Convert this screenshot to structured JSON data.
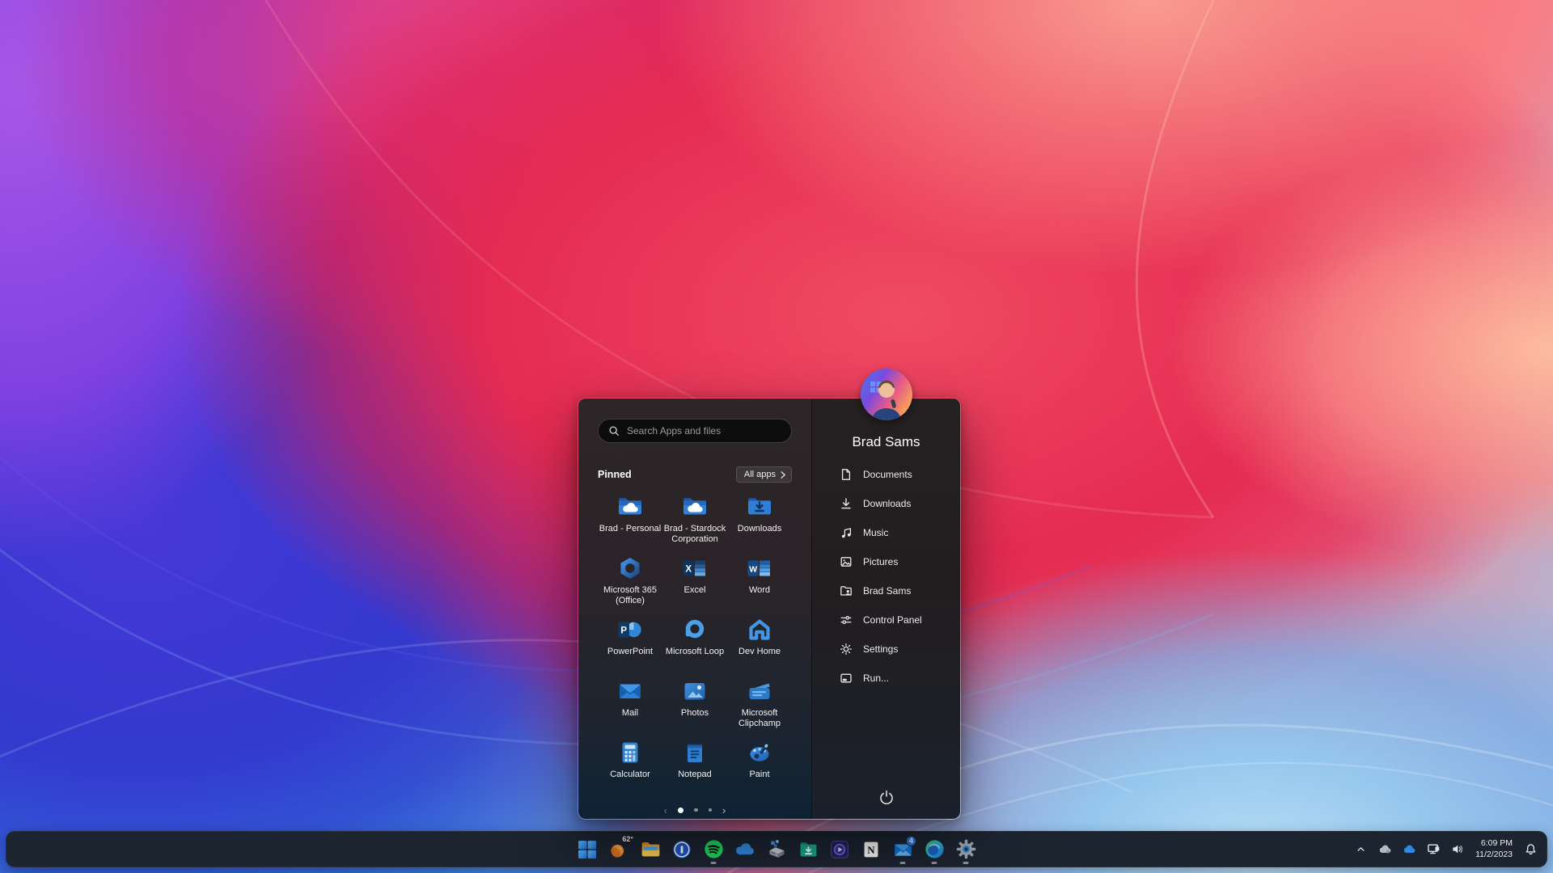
{
  "start_menu": {
    "search_placeholder": "Search Apps and files",
    "pinned_label": "Pinned",
    "all_apps_label": "All apps",
    "apps": [
      "Brad - Personal",
      "Brad - Stardock Corporation",
      "Downloads",
      "Microsoft 365 (Office)",
      "Excel",
      "Word",
      "PowerPoint",
      "Microsoft Loop",
      "Dev Home",
      "Mail",
      "Photos",
      "Microsoft Clipchamp",
      "Calculator",
      "Notepad",
      "Paint"
    ],
    "pagination": {
      "total_pages": 3,
      "active_page": 1
    },
    "user_name": "Brad Sams",
    "quick_links": [
      "Documents",
      "Downloads",
      "Music",
      "Pictures",
      "Brad Sams",
      "Control Panel",
      "Settings",
      "Run..."
    ]
  },
  "taskbar": {
    "weather_temp": "62°",
    "mail_badge": "4",
    "tray": {
      "time": "6:09 PM",
      "date": "11/2/2023"
    }
  },
  "colors": {
    "taskbar_bg": "#1c2430",
    "menu_left_bg": "#2a2428",
    "menu_right_bg": "#201d20",
    "accent_blue": "#2f7fd0",
    "badge_blue": "#2a7de8",
    "spotify_green": "#1ed760",
    "explorer_yellow": "#f5c242",
    "weather_orange": "#ef8c2a",
    "downloads_teal": "#16a88c"
  }
}
